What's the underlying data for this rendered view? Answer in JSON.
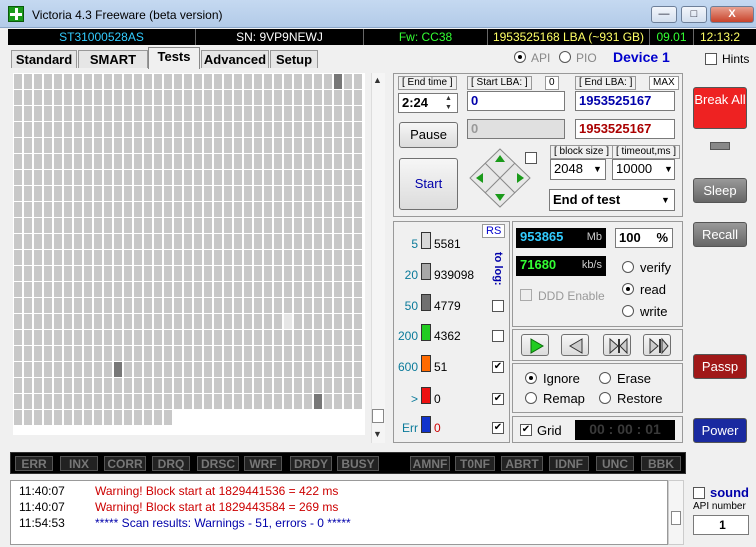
{
  "window": {
    "title": "Victoria 4.3 Freeware (beta version)",
    "minimize": "—",
    "restore": "□",
    "close": "X"
  },
  "info": {
    "model": "ST31000528AS",
    "serial": "SN: 9VP9NEWJ",
    "firmware": "Fw: CC38",
    "capacity": "1953525168 LBA (~931 GB)",
    "date": "09.01",
    "time": "12:13:2"
  },
  "tabs": [
    "Standard",
    "SMART",
    "Tests",
    "Advanced",
    "Setup"
  ],
  "mode": {
    "api": "API",
    "pio": "PIO",
    "device": "Device 1",
    "hints": "Hints"
  },
  "test": {
    "end_time_label": "[ End time ]",
    "end_time": "2:24",
    "start_lba_label": "[ Start LBA: ]",
    "start_lba_zero": "0",
    "start_lba": "0",
    "end_lba_label": "[ End LBA: ]",
    "end_lba_max": "MAX",
    "end_lba": "1953525167",
    "current_lba": "0",
    "current_end_lba": "1953525167",
    "pause": "Pause",
    "start": "Start",
    "block_size_label": "[ block size ]",
    "block_size": "2048",
    "timeout_label": "[ timeout,ms ]",
    "timeout": "10000",
    "end_action": "End of test"
  },
  "legend": {
    "rs": "RS",
    "to_log": "to log:",
    "items": [
      {
        "ms": "5",
        "count": "5581",
        "color": "#d8d8d8"
      },
      {
        "ms": "20",
        "count": "939098",
        "color": "#a8a8a8"
      },
      {
        "ms": "50",
        "count": "4779",
        "color": "#707070"
      },
      {
        "ms": "200",
        "count": "4362",
        "color": "#22cc22"
      },
      {
        "ms": "600",
        "count": "51",
        "color": "#ff6a00"
      },
      {
        "ms": ">",
        "count": "0",
        "color": "#ee1111"
      },
      {
        "ms": "Err",
        "count": "0",
        "color": "#1133cc"
      }
    ]
  },
  "stats": {
    "mb": "953865",
    "mb_unit": "Mb",
    "percent": "100",
    "percent_unit": "%",
    "speed": "71680",
    "speed_unit": "kb/s",
    "ddd": "DDD Enable"
  },
  "scan_mode": {
    "verify": "verify",
    "read": "read",
    "write": "write"
  },
  "actions": {
    "ignore": "Ignore",
    "erase": "Erase",
    "remap": "Remap",
    "restore": "Restore",
    "grid": "Grid",
    "timer": "00 : 00 : 01"
  },
  "right_buttons": {
    "break": "Break All",
    "sleep": "Sleep",
    "recall": "Recall",
    "passp": "Passp",
    "power": "Power",
    "sound": "sound",
    "api_number_label": "API number",
    "api_number": "1"
  },
  "status_flags": [
    "ERR",
    "INX",
    "CORR",
    "DRQ",
    "DRSC",
    "WRF",
    "DRDY",
    "BUSY",
    "AMNF",
    "T0NF",
    "ABRT",
    "IDNF",
    "UNC",
    "BBK"
  ],
  "log": [
    {
      "time": "11:40:07",
      "text": "Warning! Block start at 1829441536 = 422 ms",
      "color": "#cc0000"
    },
    {
      "time": "11:40:07",
      "text": "Warning! Block start at 1829443584 = 269 ms",
      "color": "#cc0000"
    },
    {
      "time": "11:54:53",
      "text": "***** Scan results: Warnings - 51, errors - 0 *****",
      "color": "#0000aa"
    }
  ]
}
